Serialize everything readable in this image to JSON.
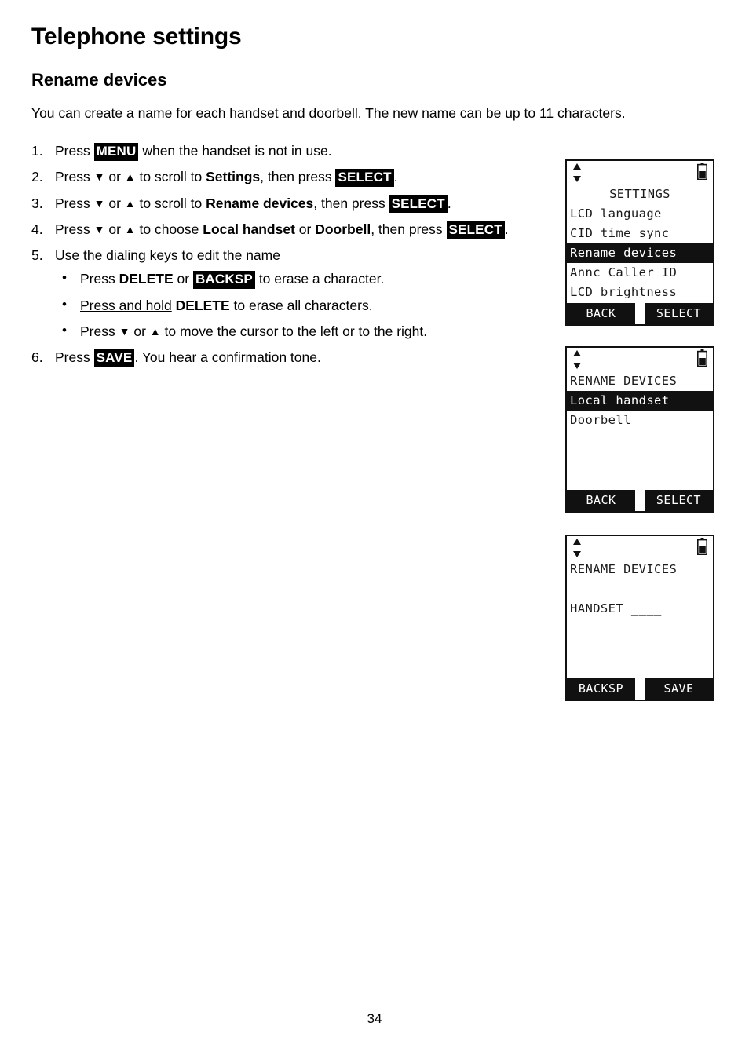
{
  "document": {
    "page_title": "Telephone settings",
    "section_title": "Rename devices",
    "intro": "You can create a name for each handset and doorbell. The new name can be up to 11 characters.",
    "page_number": "34"
  },
  "steps": [
    {
      "num": "1.",
      "parts": [
        {
          "t": "Press ",
          "style": "plain"
        },
        {
          "t": "MENU",
          "style": "key"
        },
        {
          "t": " when the handset is not in use.",
          "style": "plain"
        }
      ]
    },
    {
      "num": "2.",
      "parts": [
        {
          "t": "Press ",
          "style": "plain"
        },
        {
          "t": "▼",
          "style": "arrow"
        },
        {
          "t": " or ",
          "style": "plain"
        },
        {
          "t": "▲",
          "style": "arrow"
        },
        {
          "t": " to scroll to ",
          "style": "plain"
        },
        {
          "t": "Settings",
          "style": "bold"
        },
        {
          "t": ", then press ",
          "style": "plain"
        },
        {
          "t": "SELECT",
          "style": "key"
        },
        {
          "t": ".",
          "style": "plain"
        }
      ]
    },
    {
      "num": "3.",
      "parts": [
        {
          "t": "Press ",
          "style": "plain"
        },
        {
          "t": "▼",
          "style": "arrow"
        },
        {
          "t": " or ",
          "style": "plain"
        },
        {
          "t": "▲",
          "style": "arrow"
        },
        {
          "t": " to scroll to ",
          "style": "plain"
        },
        {
          "t": "Rename devices",
          "style": "bold"
        },
        {
          "t": ", then press ",
          "style": "plain"
        },
        {
          "t": "SELECT",
          "style": "key"
        },
        {
          "t": ".",
          "style": "plain"
        }
      ]
    },
    {
      "num": "4.",
      "parts": [
        {
          "t": "Press ",
          "style": "plain"
        },
        {
          "t": "▼",
          "style": "arrow"
        },
        {
          "t": " or ",
          "style": "plain"
        },
        {
          "t": "▲",
          "style": "arrow"
        },
        {
          "t": " to choose ",
          "style": "plain"
        },
        {
          "t": "Local handset",
          "style": "bold"
        },
        {
          "t": " or ",
          "style": "plain"
        },
        {
          "t": "Doorbell",
          "style": "bold"
        },
        {
          "t": ", then press ",
          "style": "plain"
        },
        {
          "t": "SELECT",
          "style": "key"
        },
        {
          "t": ".",
          "style": "plain"
        }
      ]
    },
    {
      "num": "5.",
      "parts": [
        {
          "t": "Use the dialing keys to edit the name",
          "style": "plain"
        }
      ],
      "bullets": [
        {
          "parts": [
            {
              "t": "Press ",
              "style": "plain"
            },
            {
              "t": "DELETE",
              "style": "bold"
            },
            {
              "t": " or ",
              "style": "plain"
            },
            {
              "t": "BACKSP",
              "style": "key"
            },
            {
              "t": " to erase a character.",
              "style": "plain"
            }
          ]
        },
        {
          "parts": [
            {
              "t": "Press and hold",
              "style": "underline"
            },
            {
              "t": " ",
              "style": "plain"
            },
            {
              "t": "DELETE",
              "style": "bold"
            },
            {
              "t": " to erase all characters.",
              "style": "plain"
            }
          ]
        },
        {
          "parts": [
            {
              "t": "Press ",
              "style": "plain"
            },
            {
              "t": "▼",
              "style": "arrow"
            },
            {
              "t": " or ",
              "style": "plain"
            },
            {
              "t": "▲",
              "style": "arrow"
            },
            {
              "t": " to move the cursor to the left or to the right.",
              "style": "plain"
            }
          ]
        }
      ]
    },
    {
      "num": "6.",
      "parts": [
        {
          "t": "Press ",
          "style": "plain"
        },
        {
          "t": "SAVE",
          "style": "key"
        },
        {
          "t": ". You hear a confirmation tone.",
          "style": "plain"
        }
      ]
    }
  ],
  "lcd_screens": [
    {
      "id": "lcd-1",
      "status": {
        "scroll_icon": "updown-arrows-icon",
        "battery_icon": "battery-icon"
      },
      "rows": [
        {
          "text": "SETTINGS",
          "align": "center",
          "highlight": false
        },
        {
          "text": "LCD language",
          "align": "left",
          "highlight": false
        },
        {
          "text": "CID time sync",
          "align": "left",
          "highlight": false
        },
        {
          "text": "Rename devices",
          "align": "left",
          "highlight": true
        },
        {
          "text": "Annc Caller ID",
          "align": "left",
          "highlight": false
        },
        {
          "text": "LCD brightness",
          "align": "left",
          "highlight": false
        }
      ],
      "soft_keys": [
        "BACK",
        "SELECT"
      ]
    },
    {
      "id": "lcd-2",
      "status": {
        "scroll_icon": "updown-arrows-icon",
        "battery_icon": "battery-icon"
      },
      "rows": [
        {
          "text": "RENAME DEVICES",
          "align": "left",
          "highlight": false
        },
        {
          "text": "Local handset",
          "align": "left",
          "highlight": true
        },
        {
          "text": "Doorbell",
          "align": "left",
          "highlight": false
        },
        {
          "text": "",
          "align": "left",
          "highlight": false
        },
        {
          "text": "",
          "align": "left",
          "highlight": false
        },
        {
          "text": "",
          "align": "left",
          "highlight": false
        }
      ],
      "soft_keys": [
        "BACK",
        "SELECT"
      ]
    },
    {
      "id": "lcd-3",
      "status": {
        "scroll_icon": "updown-arrows-icon",
        "battery_icon": "battery-icon"
      },
      "rows": [
        {
          "text": "RENAME DEVICES",
          "align": "left",
          "highlight": false
        },
        {
          "text": "",
          "align": "left",
          "highlight": false
        },
        {
          "text": "HANDSET ____",
          "align": "left",
          "highlight": false
        },
        {
          "text": "",
          "align": "left",
          "highlight": false
        },
        {
          "text": "",
          "align": "left",
          "highlight": false
        },
        {
          "text": "",
          "align": "left",
          "highlight": false
        }
      ],
      "soft_keys": [
        "BACKSP",
        "SAVE"
      ]
    }
  ]
}
